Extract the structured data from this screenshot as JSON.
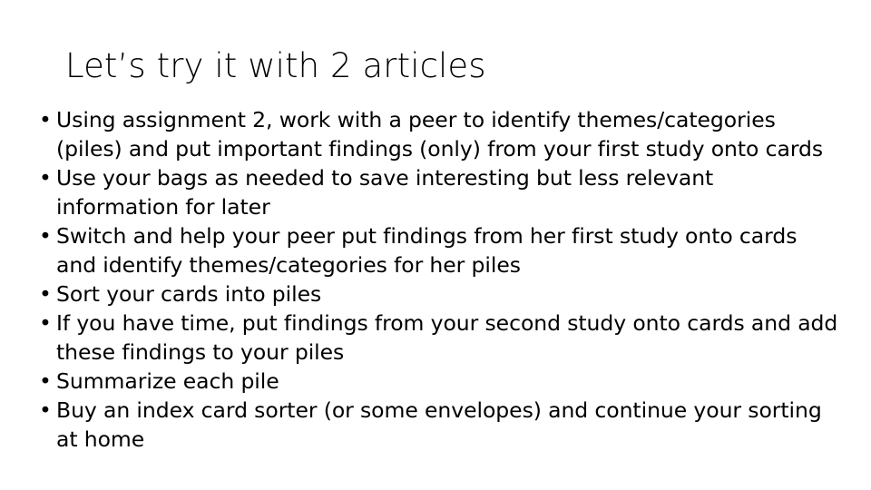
{
  "slide": {
    "title": "Let’s try it with 2 articles",
    "background_color": "#ffffff",
    "text_color": "#000000",
    "bullet_glyph": "•",
    "bullets": [
      {
        "text": "Using assignment 2, work with a peer to identify themes/categories (piles) and put important findings (only) from your first study onto cards"
      },
      {
        "text": "Use your bags as needed to save interesting but less relevant information for later"
      },
      {
        "text": "Switch and help your peer put findings from her first study onto cards and identify themes/categories for her piles"
      },
      {
        "text": "Sort your cards into piles"
      },
      {
        "text": "If you have time, put findings from your second study onto cards and add these findings to your piles"
      },
      {
        "text": "Summarize each pile"
      },
      {
        "text": "Buy an index card sorter (or some envelopes) and continue your sorting at home"
      }
    ]
  }
}
